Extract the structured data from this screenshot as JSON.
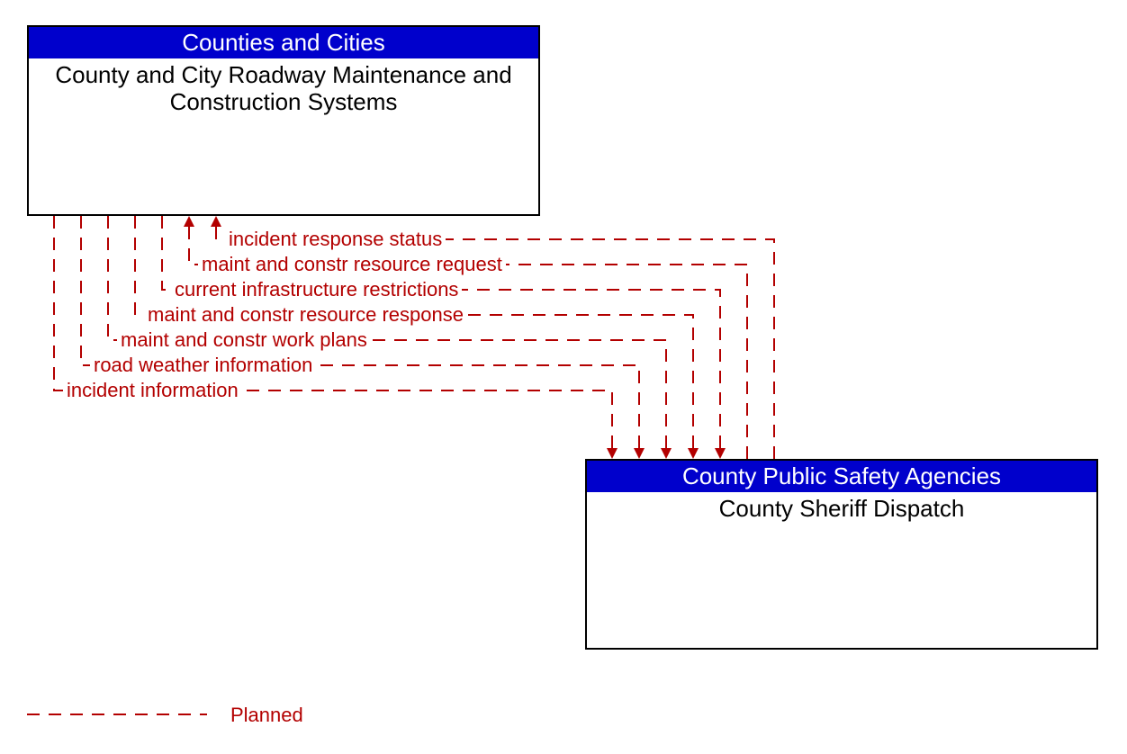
{
  "entities": {
    "top": {
      "header": "Counties and Cities",
      "body": "County and City Roadway Maintenance and Construction Systems"
    },
    "bottom": {
      "header": "County Public Safety Agencies",
      "body": "County Sheriff Dispatch"
    }
  },
  "flows": [
    {
      "label": "incident response status",
      "direction": "to_top"
    },
    {
      "label": "maint and constr resource request",
      "direction": "to_top"
    },
    {
      "label": "current infrastructure restrictions",
      "direction": "to_bottom"
    },
    {
      "label": "maint and constr resource response",
      "direction": "to_bottom"
    },
    {
      "label": "maint and constr work plans",
      "direction": "to_bottom"
    },
    {
      "label": "road weather information",
      "direction": "to_bottom"
    },
    {
      "label": "incident information",
      "direction": "to_bottom"
    }
  ],
  "legend": {
    "planned": "Planned"
  },
  "colors": {
    "header_bg": "#0000cc",
    "flow": "#b30000"
  },
  "chart_data": {
    "type": "diagram",
    "nodes": [
      {
        "id": "maint",
        "group": "Counties and Cities",
        "label": "County and City Roadway Maintenance and Construction Systems"
      },
      {
        "id": "sheriff",
        "group": "County Public Safety Agencies",
        "label": "County Sheriff Dispatch"
      }
    ],
    "edges": [
      {
        "from": "sheriff",
        "to": "maint",
        "label": "incident response status",
        "style": "planned"
      },
      {
        "from": "sheriff",
        "to": "maint",
        "label": "maint and constr resource request",
        "style": "planned"
      },
      {
        "from": "maint",
        "to": "sheriff",
        "label": "current infrastructure restrictions",
        "style": "planned"
      },
      {
        "from": "maint",
        "to": "sheriff",
        "label": "maint and constr resource response",
        "style": "planned"
      },
      {
        "from": "maint",
        "to": "sheriff",
        "label": "maint and constr work plans",
        "style": "planned"
      },
      {
        "from": "maint",
        "to": "sheriff",
        "label": "road weather information",
        "style": "planned"
      },
      {
        "from": "maint",
        "to": "sheriff",
        "label": "incident information",
        "style": "planned"
      }
    ],
    "legend": [
      {
        "style": "planned",
        "label": "Planned",
        "line": "dashed",
        "color": "#b30000"
      }
    ]
  }
}
